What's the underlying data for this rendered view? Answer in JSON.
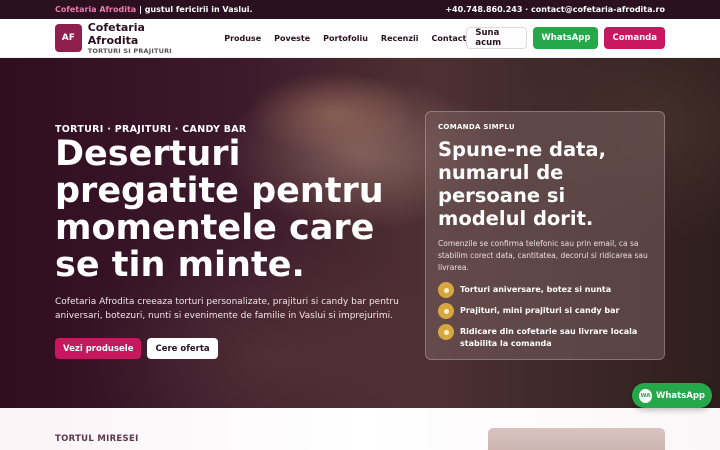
{
  "topbar": {
    "brand": "Cofetaria Afrodita",
    "separator": "|",
    "tagline": "gustul fericirii in Vaslui.",
    "contact": "+40.748.860.243 · contact@cofetaria-afrodita.ro"
  },
  "header": {
    "logo_initials": "AF",
    "logo_name": "Cofetaria Afrodita",
    "logo_subtitle": "TORTURI SI PRAJITURI",
    "nav": [
      {
        "label": "Produse"
      },
      {
        "label": "Poveste"
      },
      {
        "label": "Portofoliu"
      },
      {
        "label": "Recenzii"
      },
      {
        "label": "Contact"
      }
    ],
    "call_label": "Suna acum",
    "whatsapp_label": "WhatsApp",
    "order_label": "Comanda"
  },
  "hero": {
    "eyebrow": "TORTURI · PRAJITURI · CANDY BAR",
    "title": "Deserturi pregatite pentru momentele care se tin minte.",
    "description": "Cofetaria Afrodita creeaza torturi personalizate, prajituri si candy bar pentru aniversari, botezuri, nunti si evenimente de familie in Vaslui si imprejurimi.",
    "primary_button": "Vezi produsele",
    "secondary_button": "Cere oferta"
  },
  "order_card": {
    "eyebrow": "COMANDA SIMPLU",
    "title": "Spune-ne data, numarul de persoane si modelul dorit.",
    "description": "Comenzile se confirma telefonic sau prin email, ca sa stabilim corect data, cantitatea, decorul si ridicarea sau livrarea.",
    "items": [
      {
        "label": "Torturi aniversare, botez si nunta"
      },
      {
        "label": "Prajituri, mini prajituri si candy bar"
      },
      {
        "label": "Ridicare din cofetarie sau livrare locala stabilita la comanda"
      }
    ]
  },
  "floating_whatsapp": {
    "icon_text": "WA",
    "label": "WhatsApp"
  },
  "next_section": {
    "eyebrow": "TORTUL MIRESEI"
  },
  "colors": {
    "brand_dark": "#2a1020",
    "brand_pink": "#c8175f",
    "whatsapp_green": "#25a84a",
    "bullet_gold": "#d8a640"
  }
}
